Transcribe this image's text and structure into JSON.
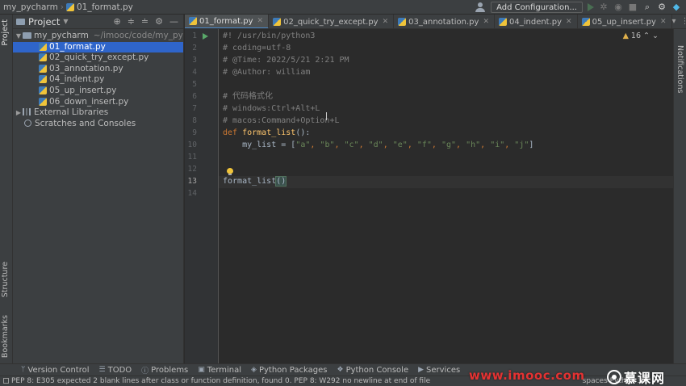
{
  "titlebar": {
    "project": "my_pycharm",
    "file": "01_format.py",
    "add_config": "Add Configuration..."
  },
  "sidebar_left": {
    "project_label": "Project",
    "structure_label": "Structure",
    "bookmarks_label": "Bookmarks"
  },
  "project_panel": {
    "title": "Project",
    "root_name": "my_pycharm",
    "root_path": "~/imooc/code/my_py",
    "files": [
      "01_format.py",
      "02_quick_try_except.py",
      "03_annotation.py",
      "04_indent.py",
      "05_up_insert.py",
      "06_down_insert.py"
    ],
    "external_libraries": "External Libraries",
    "scratches": "Scratches and Consoles"
  },
  "tabs": [
    "01_format.py",
    "02_quick_try_except.py",
    "03_annotation.py",
    "04_indent.py",
    "05_up_insert.py"
  ],
  "editor": {
    "warning_count": "16",
    "line_numbers": [
      "1",
      "2",
      "3",
      "4",
      "5",
      "6",
      "7",
      "8",
      "9",
      "10",
      "11",
      "12",
      "13",
      "14"
    ],
    "current_line": 13,
    "lines": {
      "l1": "#! /usr/bin/python3",
      "l2": "# coding=utf-8",
      "l3": "# @Time: 2022/5/21 2:21 PM",
      "l4": "# @Author: william",
      "l6": "# 代码格式化",
      "l7": "# windows:Ctrl+Alt+L",
      "l8": "# macos:Command+Option+L",
      "l9_kw": "def",
      "l9_fn": "format_list",
      "l9_rest": "():",
      "l10_a": "    my_list = [",
      "l10_items": [
        "\"a\"",
        "\"b\"",
        "\"c\"",
        "\"d\"",
        "\"e\"",
        "\"f\"",
        "\"g\"",
        "\"h\"",
        "\"i\"",
        "\"j\""
      ],
      "l10_end": "]",
      "l13_call": "format_list",
      "l13_paren": "()"
    }
  },
  "right_strip": {
    "notifications_label": "Notifications"
  },
  "bottom_tools": [
    "Version Control",
    "TODO",
    "Problems",
    "Terminal",
    "Python Packages",
    "Python Console",
    "Services"
  ],
  "statusbar": {
    "message": "PEP 8: E305 expected 2 blank lines after class or function definition, found 0. PEP 8: W292 no newline at end of file",
    "right": "spaces  Python 3.9"
  },
  "watermark": {
    "url": "www.imooc.com",
    "logo_text": "慕课网"
  },
  "colors": {
    "accent": "#2f65ca",
    "keyword": "#cc7832",
    "function": "#ffc66d",
    "string": "#6a8759",
    "comment": "#808080",
    "watermark": "#e33232"
  }
}
